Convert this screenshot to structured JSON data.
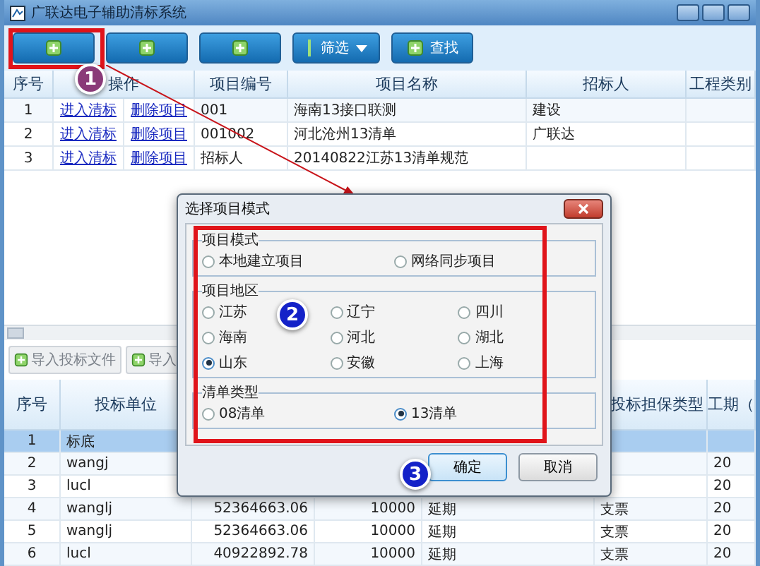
{
  "window": {
    "title": "广联达电子辅助清标系统"
  },
  "toolbar": {
    "buttons": [
      {
        "kind": "plain"
      },
      {
        "kind": "plain"
      },
      {
        "kind": "plain"
      },
      {
        "kind": "dropdown",
        "label": "筛选"
      },
      {
        "kind": "plain",
        "label": "查找"
      }
    ]
  },
  "projects_table": {
    "columns": [
      "序号",
      "操作",
      "项目编号",
      "项目名称",
      "招标人",
      "工程类别"
    ],
    "rows": [
      {
        "index": "1",
        "open": "进入清标",
        "delete": "删除项目",
        "code": "001",
        "name": "海南13接口联测",
        "tenderer": "建设"
      },
      {
        "index": "2",
        "open": "进入清标",
        "delete": "删除项目",
        "code": "001002",
        "name": "河北沧州13清单",
        "tenderer": "广联达"
      },
      {
        "index": "3",
        "open": "进入清标",
        "delete": "删除项目",
        "code": "招标人",
        "name": "20140822江苏13清单规范"
      }
    ]
  },
  "bids_toolbar": {
    "buttons": [
      "导入投标文件",
      "导入"
    ]
  },
  "bids_table": {
    "columns": [
      "序号",
      "投标单位",
      "投标担保类型",
      "工期（"
    ],
    "rows": [
      {
        "selected": true,
        "index": "1",
        "bidder": "标底"
      },
      {
        "selected": false,
        "index": "2",
        "bidder": "wangj",
        "duration": "20"
      },
      {
        "selected": false,
        "index": "3",
        "bidder": "lucl",
        "duration": "20"
      },
      {
        "selected": false,
        "index": "4",
        "bidder": "wanglj",
        "column_3": "52364663.06",
        "column_4": "10000",
        "column_5": "延期",
        "guarantee": "支票",
        "duration": "20"
      },
      {
        "selected": false,
        "index": "5",
        "bidder": "wanglj",
        "column_3": "52364663.06",
        "column_4": "10000",
        "column_5": "延期",
        "guarantee": "支票",
        "duration": "20"
      },
      {
        "selected": false,
        "index": "6",
        "bidder": "lucl",
        "column_3": "40922892.78",
        "column_4": "10000",
        "column_5": "延期",
        "guarantee": "支票",
        "duration": "20"
      }
    ]
  },
  "dialog": {
    "title": "选择项目模式",
    "groups": [
      {
        "title": "项目模式",
        "options": [
          {
            "label": "本地建立项目",
            "selected": false
          },
          {
            "label": "网络同步项目",
            "selected": false
          }
        ]
      },
      {
        "title": "项目地区",
        "options": [
          {
            "label": "江苏",
            "selected": false
          },
          {
            "label": "辽宁",
            "selected": false
          },
          {
            "label": "四川",
            "selected": false
          },
          {
            "label": "海南",
            "selected": false
          },
          {
            "label": "河北",
            "selected": false
          },
          {
            "label": "湖北",
            "selected": false
          },
          {
            "label": "山东",
            "selected": true
          },
          {
            "label": "安徽",
            "selected": false
          },
          {
            "label": "上海",
            "selected": false
          }
        ]
      },
      {
        "title": "清单类型",
        "options": [
          {
            "label": "08清单",
            "selected": false
          },
          {
            "label": "13清单",
            "selected": true
          }
        ]
      }
    ],
    "buttons": [
      {
        "label": "确定",
        "focused": true
      },
      {
        "label": "取消",
        "focused": false
      }
    ]
  },
  "annotations": [
    "1",
    "2",
    "3"
  ]
}
